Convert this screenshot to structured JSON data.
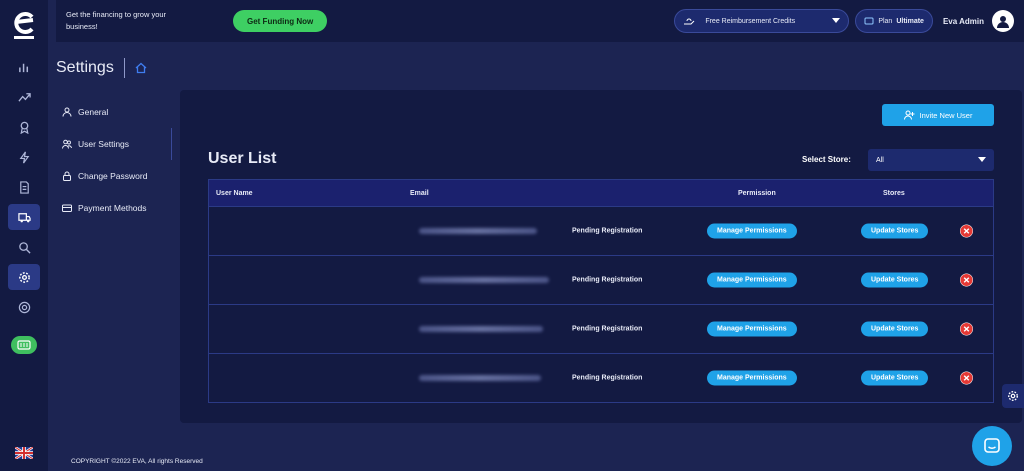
{
  "colors": {
    "background": "#1c2452",
    "panel": "#131a42",
    "accent_blue": "#1fa2e8",
    "accent_green": "#3ecf63",
    "delete_red": "#e53935"
  },
  "topbar": {
    "promo_text": "Get the financing to grow your business!",
    "funding_button": "Get Funding Now",
    "credits_label": "Free Reimbursement Credits",
    "plan_prefix": "Plan",
    "plan_name": "Ultimate",
    "user_name": "Eva Admin"
  },
  "rail": {
    "icons": [
      "chart-bar-icon",
      "trend-up-icon",
      "award-icon",
      "bolt-icon",
      "document-icon",
      "truck-icon",
      "search-icon",
      "gear-icon",
      "support-icon",
      "credits-icon"
    ],
    "active": "gear-icon"
  },
  "page": {
    "title": "Settings"
  },
  "settings_nav": {
    "items": [
      {
        "label": "General",
        "icon": "user-icon"
      },
      {
        "label": "User Settings",
        "icon": "users-icon"
      },
      {
        "label": "Change Password",
        "icon": "lock-icon"
      },
      {
        "label": "Payment Methods",
        "icon": "card-icon"
      }
    ],
    "active": "User Settings"
  },
  "user_list": {
    "invite_button": "Invite New User",
    "title": "User List",
    "select_store_label": "Select Store:",
    "select_store_value": "All",
    "columns": [
      "User Name",
      "Email",
      "Permission",
      "Stores"
    ],
    "rows": [
      {
        "status": "Pending Registration",
        "permission_button": "Manage Permissions",
        "stores_button": "Update Stores"
      },
      {
        "status": "Pending Registration",
        "permission_button": "Manage Permissions",
        "stores_button": "Update Stores"
      },
      {
        "status": "Pending Registration",
        "permission_button": "Manage Permissions",
        "stores_button": "Update Stores"
      },
      {
        "status": "Pending Registration",
        "permission_button": "Manage Permissions",
        "stores_button": "Update Stores"
      }
    ]
  },
  "footer": {
    "copyright": "COPYRIGHT ©2022 EVA, All rights Reserved"
  }
}
